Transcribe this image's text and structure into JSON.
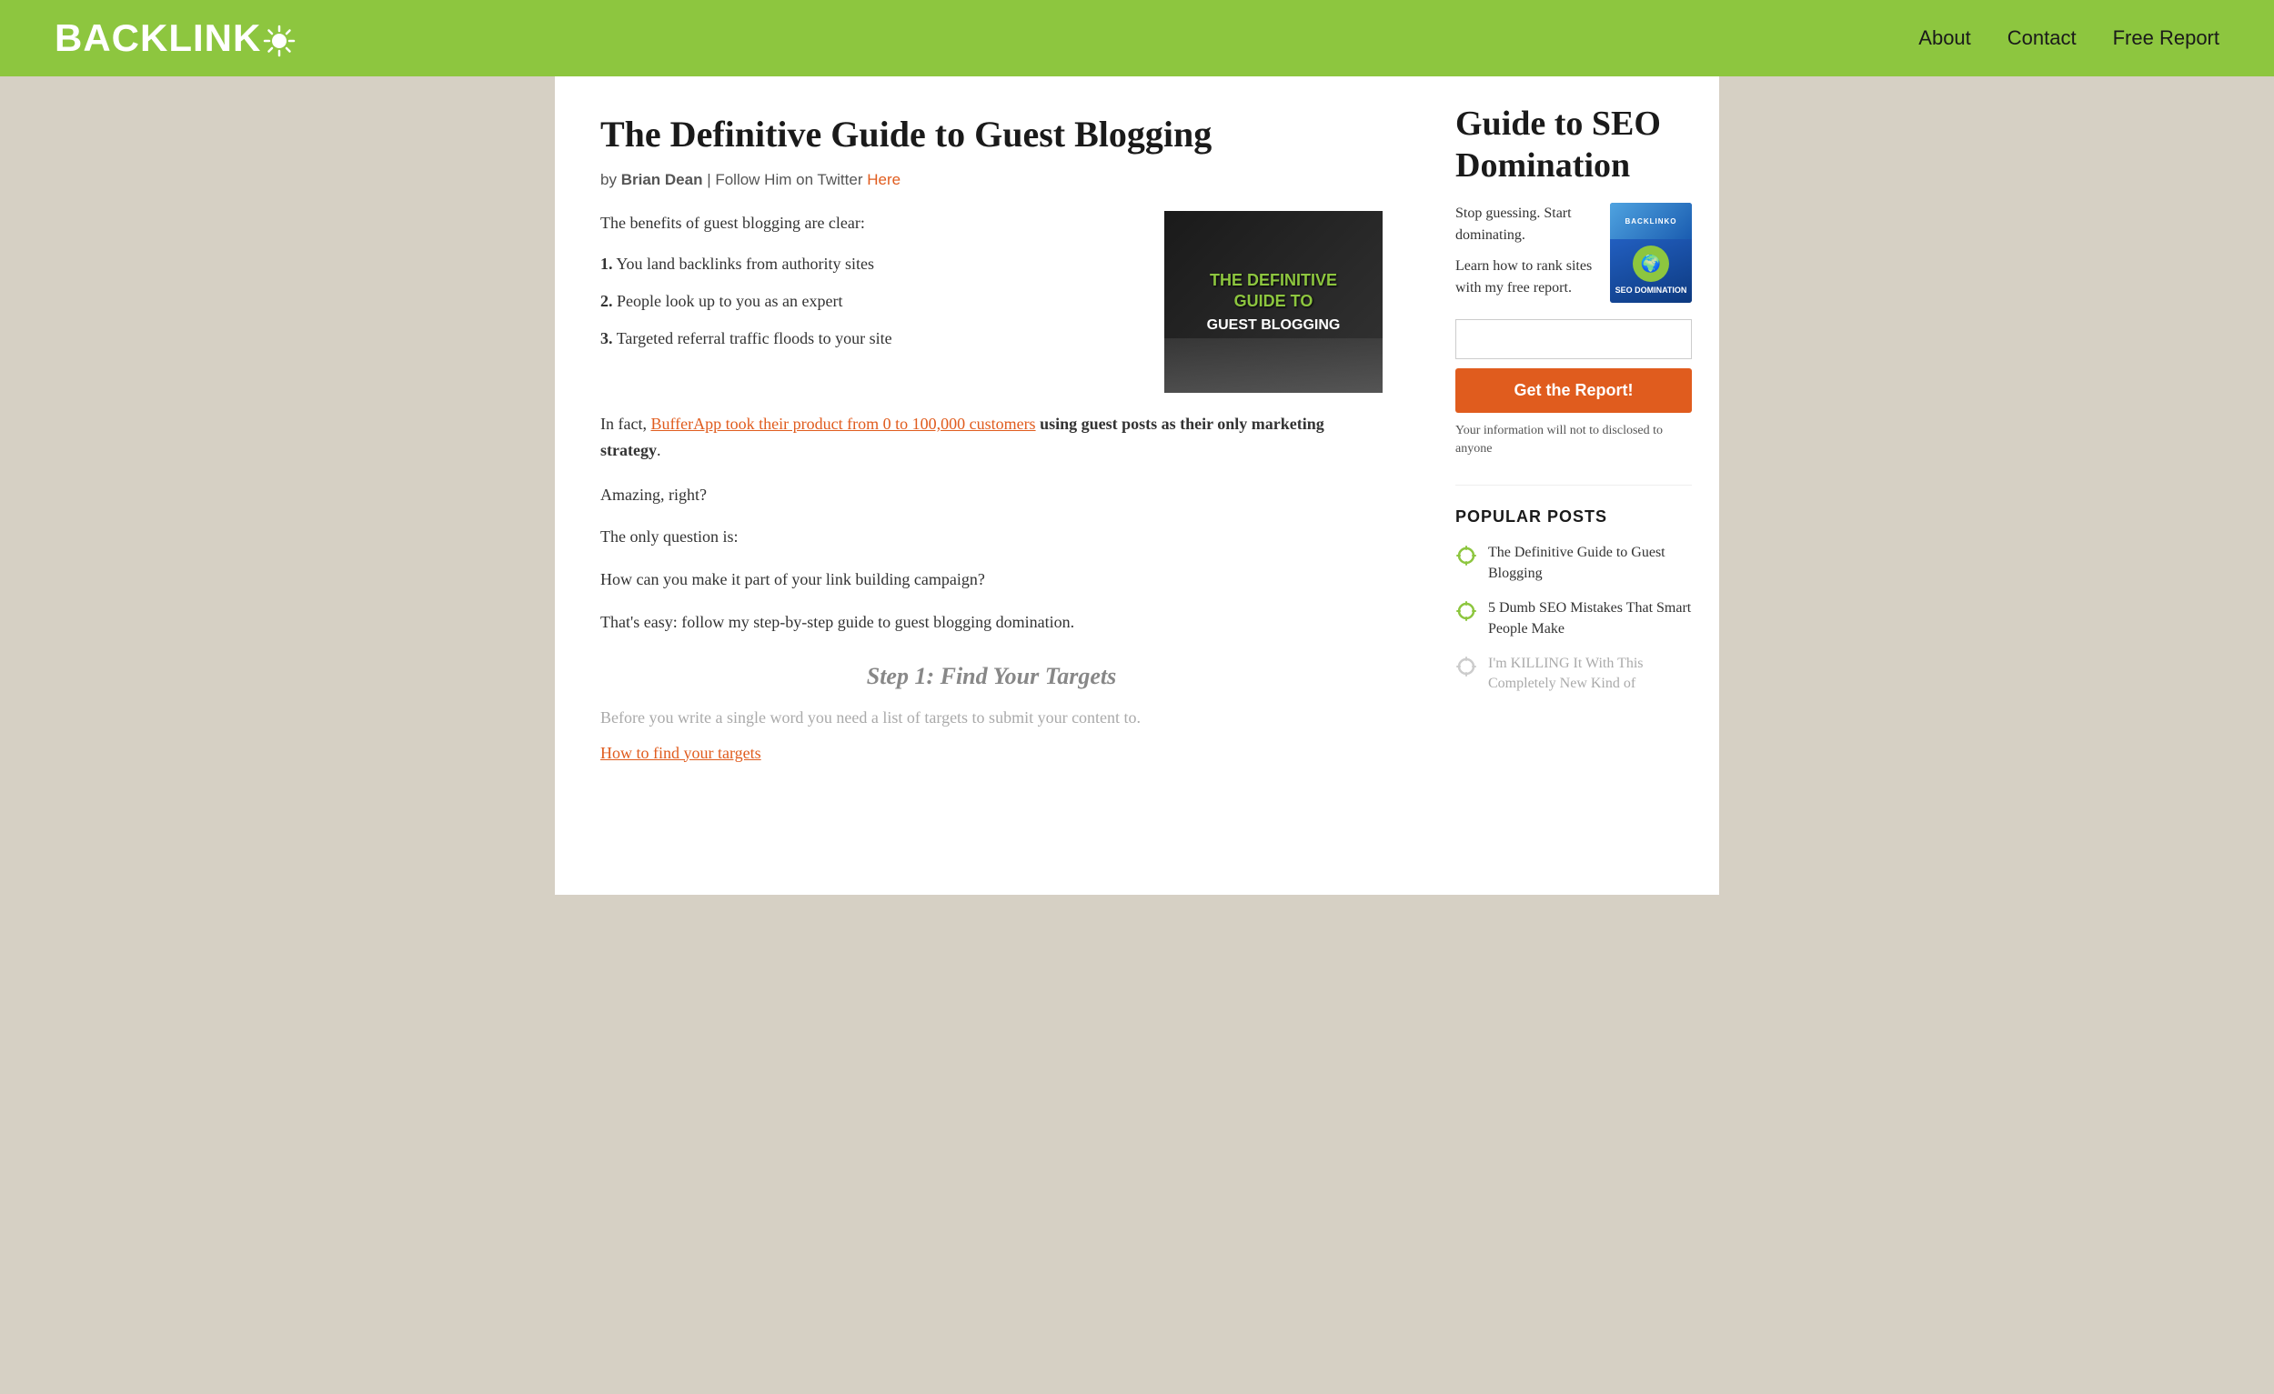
{
  "header": {
    "logo_text": "Backlink",
    "nav": {
      "about": "About",
      "contact": "Contact",
      "free_report": "Free Report"
    }
  },
  "article": {
    "title": "The Definitive Guide to Guest Blogging",
    "author_prefix": "by",
    "author_name": "Brian Dean",
    "author_separator": "  |  Follow Him on Twitter",
    "author_link_text": "Here",
    "intro": "The benefits of guest blogging are clear:",
    "benefits": [
      {
        "num": "1.",
        "text": "You land backlinks from authority sites"
      },
      {
        "num": "2.",
        "text": "People look up to you as an expert"
      },
      {
        "num": "3.",
        "text": "Targeted referral traffic floods to your site"
      }
    ],
    "bufferapp_prefix": "In fact, ",
    "bufferapp_link_text": "BufferApp took their product from 0 to 100,000 customers",
    "bufferapp_suffix": " using guest posts as their only marketing strategy",
    "bufferapp_period": ".",
    "para1": "Amazing, right?",
    "para2": "The only question is:",
    "para3": "How can you make it part of your link building campaign?",
    "para4": "That's easy: follow my step-by-step guide to guest blogging domination.",
    "step1_heading": "Step 1: Find Your Targets",
    "step1_para": "Before you write a single word you need a list of targets to submit your content to.",
    "step1_link": "How to find your targets"
  },
  "featured_image": {
    "line1": "THE DEFINITIVE",
    "line2": "GUIDE TO",
    "line3": "GUEST BLOGGING"
  },
  "sidebar": {
    "report_title": "Guide to SEO Domination",
    "desc_line1": "Stop guessing. Start dominating.",
    "desc_line2": "Learn how to rank sites with my free report.",
    "book_label": "SEO DOMINATION",
    "email_placeholder": "",
    "btn_label": "Get the Report!",
    "privacy_text": "Your information will not to disclosed to anyone",
    "popular_posts_title": "Popular Posts",
    "popular_posts": [
      {
        "text": "The Definitive Guide to Guest Blogging",
        "icon_color": "green"
      },
      {
        "text": "5 Dumb SEO Mistakes That Smart People Make",
        "icon_color": "green"
      },
      {
        "text": "I'm KILLING It With This Completely New Kind of",
        "icon_color": "gray"
      }
    ]
  }
}
